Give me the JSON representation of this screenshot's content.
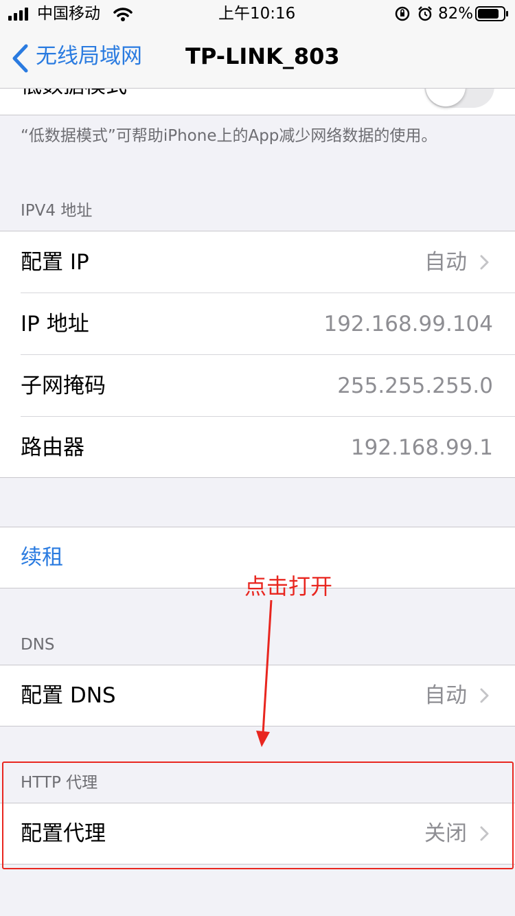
{
  "status_bar": {
    "carrier": "中国移动",
    "time": "上午10:16",
    "battery_percent": "82%",
    "battery_level": 0.82,
    "icons": [
      "signal-icon",
      "wifi-icon",
      "orientation-lock-icon",
      "alarm-icon",
      "battery-icon"
    ]
  },
  "nav": {
    "back_label": "无线局域网",
    "title": "TP-LINK_803"
  },
  "low_data": {
    "label": "低数据模式",
    "toggle_on": false,
    "footer": "“低数据模式”可帮助iPhone上的App减少网络数据的使用。"
  },
  "ipv4": {
    "header": "IPV4 地址",
    "rows": [
      {
        "label": "配置 IP",
        "value": "自动"
      },
      {
        "label": "IP 地址",
        "value": "192.168.99.104"
      },
      {
        "label": "子网掩码",
        "value": "255.255.255.0"
      },
      {
        "label": "路由器",
        "value": "192.168.99.1"
      }
    ]
  },
  "renew": {
    "label": "续租"
  },
  "dns": {
    "header": "DNS",
    "row": {
      "label": "配置 DNS",
      "value": "自动"
    }
  },
  "http_proxy": {
    "header": "HTTP 代理",
    "row": {
      "label": "配置代理",
      "value": "关闭"
    }
  },
  "annotation": {
    "text": "点击打开",
    "color": "#e8261f"
  },
  "colors": {
    "accent": "#2a7be0",
    "background": "#f2f2f7",
    "annotation_red": "#e8261f"
  }
}
